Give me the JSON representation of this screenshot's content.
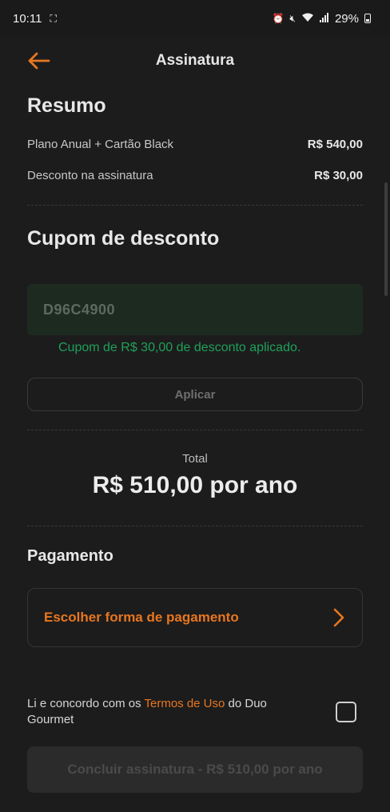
{
  "status_bar": {
    "time": "10:11",
    "battery": "29%"
  },
  "header": {
    "title": "Assinatura"
  },
  "summary": {
    "title": "Resumo",
    "items": [
      {
        "label": "Plano Anual + Cartão Black",
        "value": "R$ 540,00"
      },
      {
        "label": "Desconto na assinatura",
        "value": "R$ 30,00"
      }
    ]
  },
  "coupon": {
    "title": "Cupom de desconto",
    "code": "D96C4900",
    "message": "Cupom de R$ 30,00 de desconto aplicado.",
    "apply_label": "Aplicar"
  },
  "total": {
    "label": "Total",
    "value": "R$ 510,00 por ano"
  },
  "payment": {
    "title": "Pagamento",
    "choose_label": "Escolher forma de pagamento"
  },
  "terms": {
    "prefix": "Li e concordo com os ",
    "link": "Termos de Uso",
    "suffix": " do Duo Gourmet"
  },
  "submit": {
    "label": "Concluir assinatura - R$ 510,00 por ano"
  },
  "colors": {
    "accent": "#e8761f",
    "success": "#1fa15a",
    "background": "#1c1c1c"
  }
}
